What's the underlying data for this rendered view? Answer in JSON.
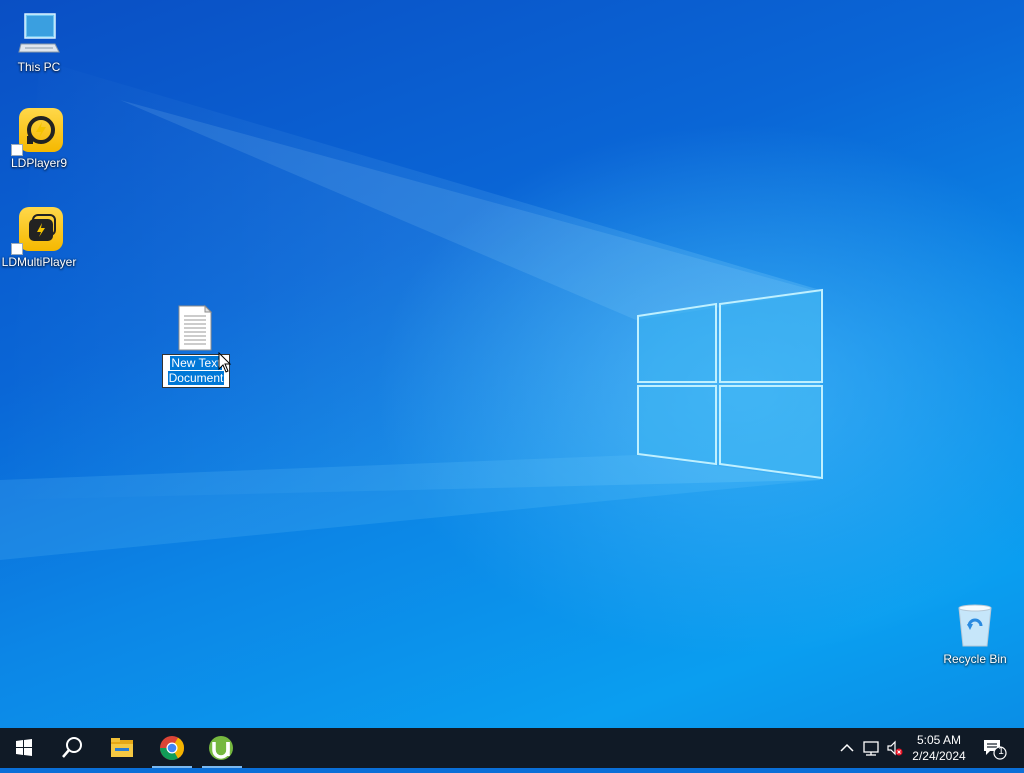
{
  "desktop": {
    "icons": [
      {
        "label": "This PC",
        "icon": "this-pc-icon"
      },
      {
        "label": "LDPlayer9",
        "icon": "ldplayer9-icon"
      },
      {
        "label": "LDMultiPlayer",
        "icon": "ldmultiplayer-icon"
      },
      {
        "label": "Recycle Bin",
        "icon": "recycle-bin-icon"
      }
    ],
    "new_file": {
      "icon": "text-document-icon",
      "rename_line1": "New Text",
      "rename_line2": "Document"
    }
  },
  "taskbar": {
    "start_icon": "windows-start-icon",
    "search_icon": "search-icon",
    "apps": [
      {
        "icon": "file-explorer-icon",
        "active": false
      },
      {
        "icon": "chrome-icon",
        "active": true
      },
      {
        "icon": "utorrent-icon",
        "active": true
      }
    ],
    "tray": {
      "icons": [
        "show-hidden-icons-chevron-icon",
        "network-icon",
        "volume-muted-icon"
      ],
      "time": "5:05 AM",
      "date": "2/24/2024",
      "notification_count": "1"
    }
  },
  "colors": {
    "taskbar": "#101a26",
    "selection": "#0078d7",
    "accent_underline": "#7ab8f0"
  }
}
